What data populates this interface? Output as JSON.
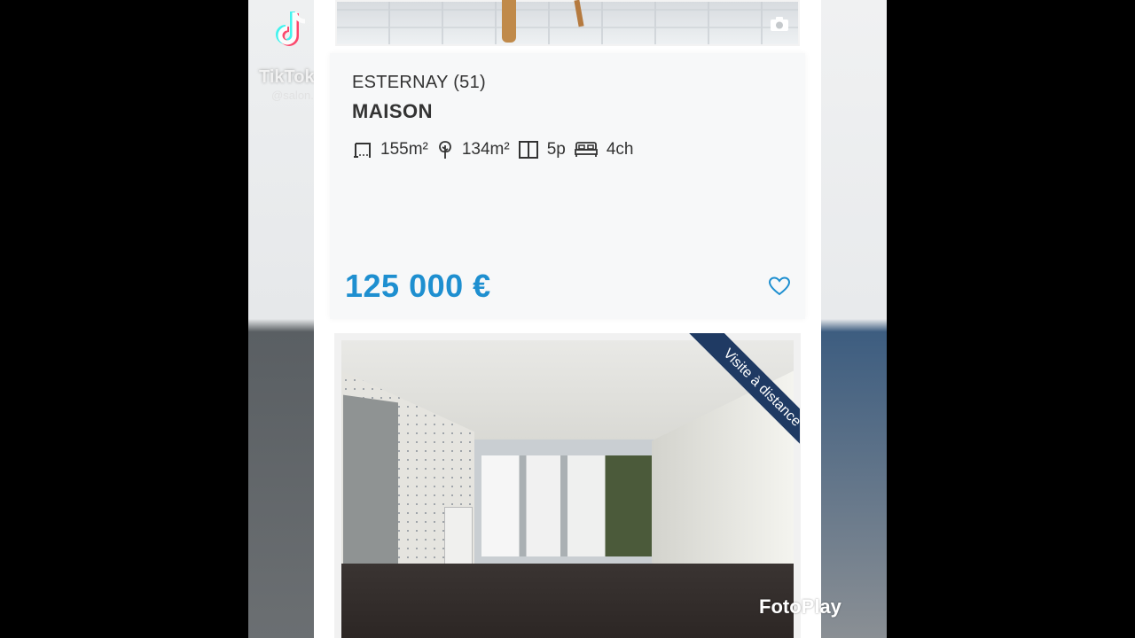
{
  "watermark": {
    "app": "TikTok",
    "user": "@salon..."
  },
  "listing": {
    "city": "ESTERNAY (51)",
    "type": "MAISON",
    "specs": {
      "surface": "155m²",
      "land": "134m²",
      "rooms": "5p",
      "bedrooms": "4ch"
    },
    "price": "125 000 €"
  },
  "next_listing": {
    "badge": "Visite à distance"
  },
  "overlay": {
    "brand": "FotoPlay"
  },
  "colors": {
    "price": "#1e8fd0",
    "ribbon": "#1f3a63"
  },
  "icons": [
    "camera-icon",
    "surface-icon",
    "tree-icon",
    "rooms-icon",
    "bed-icon",
    "heart-icon"
  ]
}
